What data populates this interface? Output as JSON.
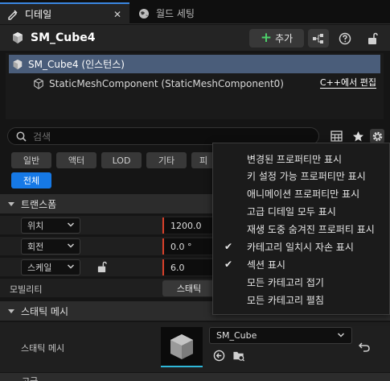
{
  "tabs": [
    {
      "label": "디테일",
      "active": true,
      "closable": true,
      "icon": "details-icon"
    },
    {
      "label": "월드 세팅",
      "active": false,
      "icon": "globe-icon"
    }
  ],
  "header": {
    "title": "SM_Cube4",
    "add_label": "추가",
    "accent_add": "#4cd06a"
  },
  "tree": {
    "root_label": "SM_Cube4 (인스턴스)",
    "child_label": "StaticMeshComponent (StaticMeshComponent0)",
    "edit_cpp_label": "C++에서 편집"
  },
  "search": {
    "placeholder": "검색"
  },
  "filters": [
    "일반",
    "액터",
    "LOD",
    "기타",
    "피"
  ],
  "filter_all": "전체",
  "sections": {
    "transform": "트랜스폼",
    "static_mesh": "스태틱 메시",
    "advanced": "고급"
  },
  "transform": {
    "location": {
      "label": "위치",
      "value": "1200.0"
    },
    "rotation": {
      "label": "회전",
      "value": "0.0 °"
    },
    "scale": {
      "label": "스케일",
      "value": "6.0"
    },
    "mobility": {
      "label": "모빌리티",
      "value": "스태틱"
    }
  },
  "static_mesh": {
    "label": "스태틱 메시",
    "asset": "SM_Cube"
  },
  "menu": {
    "items": [
      {
        "label": "변경된 프로퍼티만 표시",
        "checked": false
      },
      {
        "label": "키 설정 가능 프로퍼티만 표시",
        "checked": false
      },
      {
        "label": "애니메이션 프로퍼티만 표시",
        "checked": false
      },
      {
        "label": "고급 디테일 모두 표시",
        "checked": false
      },
      {
        "label": "재생 도중 숨겨진 프로퍼티 표시",
        "checked": false
      },
      {
        "label": "카테고리 일치시 자손 표시",
        "checked": true
      },
      {
        "label": "섹션 표시",
        "checked": true
      },
      {
        "label": "모든 카테고리 접기",
        "checked": false
      },
      {
        "label": "모든 카테고리 펼침",
        "checked": false
      }
    ]
  },
  "colors": {
    "active_tab": "#3a86e0",
    "selected_row": "#4a5d7a",
    "all_filter": "#1679e6",
    "axis_x": "#d8402a",
    "thumb_accent": "#2fb6d8"
  }
}
